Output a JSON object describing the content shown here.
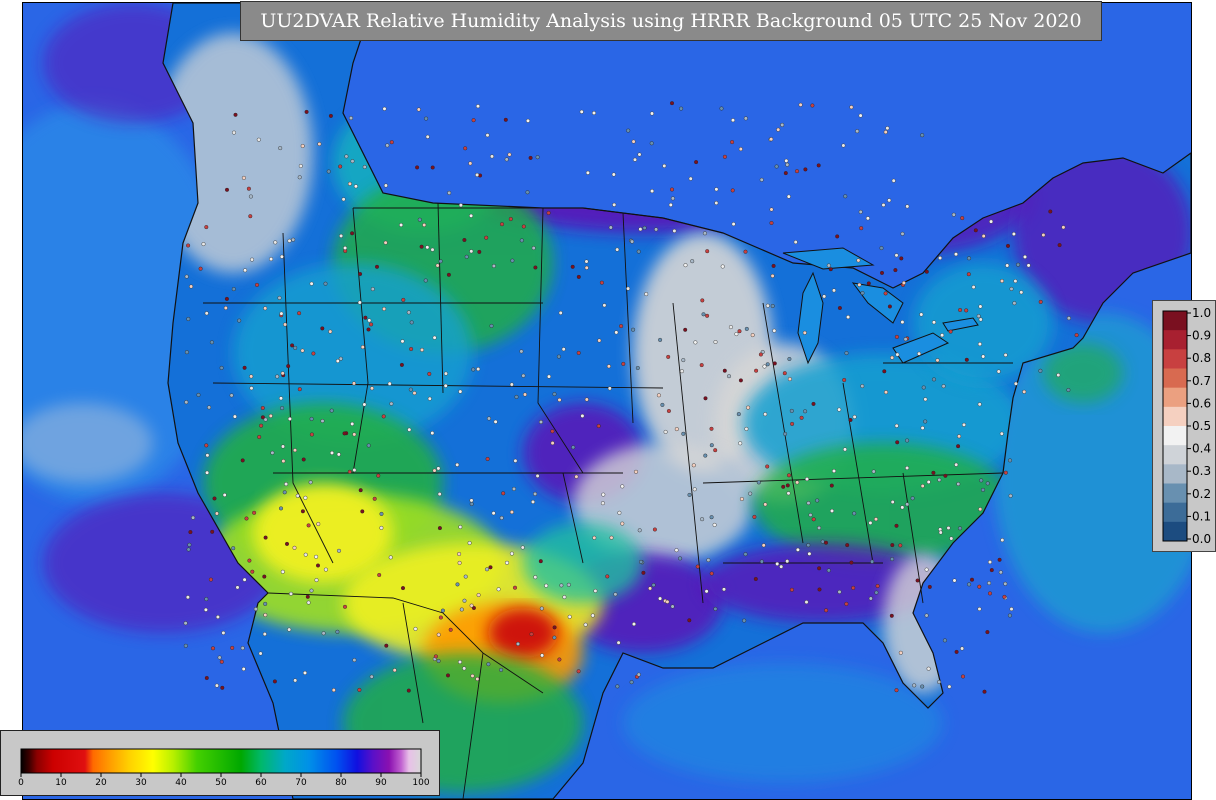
{
  "title": "UU2DVAR Relative Humidity Analysis using HRRR Background 05 UTC 25 Nov 2020",
  "rh_colorbar": {
    "ticks": [
      "0",
      "10",
      "20",
      "30",
      "40",
      "50",
      "60",
      "70",
      "80",
      "90",
      "100"
    ],
    "stops": [
      {
        "at": 0,
        "color": "#000000"
      },
      {
        "at": 2,
        "color": "#3a0000"
      },
      {
        "at": 4,
        "color": "#8b0000"
      },
      {
        "at": 8,
        "color": "#cc0000"
      },
      {
        "at": 16,
        "color": "#e01010"
      },
      {
        "at": 18,
        "color": "#ff6a00"
      },
      {
        "at": 22,
        "color": "#ff9a00"
      },
      {
        "at": 27,
        "color": "#ffd000"
      },
      {
        "at": 33,
        "color": "#ffff00"
      },
      {
        "at": 38,
        "color": "#b8f000"
      },
      {
        "at": 44,
        "color": "#44d000"
      },
      {
        "at": 55,
        "color": "#00a800"
      },
      {
        "at": 60,
        "color": "#00b86a"
      },
      {
        "at": 66,
        "color": "#00a8c8"
      },
      {
        "at": 72,
        "color": "#0090e8"
      },
      {
        "at": 79,
        "color": "#0050f0"
      },
      {
        "at": 84,
        "color": "#1010e0"
      },
      {
        "at": 88,
        "color": "#5a10c8"
      },
      {
        "at": 92,
        "color": "#8a10b0"
      },
      {
        "at": 95,
        "color": "#c060d0"
      },
      {
        "at": 97,
        "color": "#e8c0e8"
      },
      {
        "at": 100,
        "color": "#d8d8d8"
      }
    ]
  },
  "obs_colorbar": {
    "ticks": [
      "1.0",
      "0.9",
      "0.8",
      "0.7",
      "0.6",
      "0.5",
      "0.4",
      "0.3",
      "0.2",
      "0.1",
      "0.0"
    ],
    "colors": [
      "#7a1020",
      "#a82030",
      "#c84040",
      "#d86a50",
      "#eba080",
      "#f5d0c0",
      "#f2f2f2",
      "#cfd3d8",
      "#a8b8c8",
      "#6890b0",
      "#3c6c98",
      "#1c4c80"
    ]
  },
  "map_colors": {
    "ocean": "#2a66e6",
    "ocean_light": "#2a8ee8",
    "moist": "#5a18b8",
    "saturated": "#d6d6d6",
    "mid": "#1aa8d0",
    "green": "#20b040",
    "dry_yellow": "#f0f020",
    "dry_orange": "#ff9a00",
    "dry_red": "#cc1010",
    "border": "#111111"
  }
}
